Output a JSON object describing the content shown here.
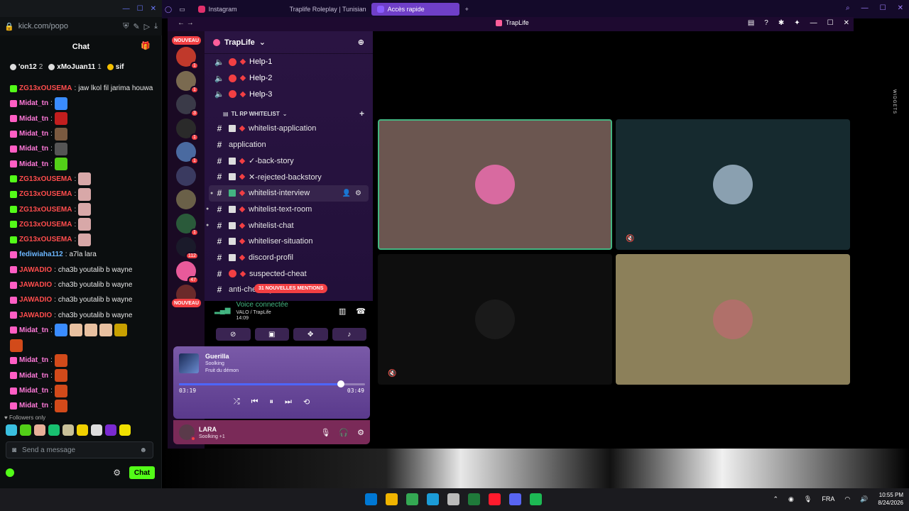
{
  "kick": {
    "url": "kick.com/popo",
    "chat_title": "Chat",
    "top_users": [
      {
        "name": "'on12",
        "count": "2"
      },
      {
        "name": "xMoJuan11",
        "count": "1"
      },
      {
        "name": "sif",
        "count": ""
      }
    ],
    "messages": [
      {
        "user": "ZG13xOUSEMA",
        "text": "jaw lkol fil jarima houwa",
        "color": "#ff4d4d",
        "badge": "green"
      },
      {
        "user": "Midat_tn",
        "text": "",
        "color": "#ff7ad9",
        "badge": "pink",
        "emotes": [
          "#3a8cff"
        ]
      },
      {
        "user": "Midat_tn",
        "text": "",
        "color": "#ff7ad9",
        "badge": "pink",
        "emotes": [
          "#c21e1e"
        ]
      },
      {
        "user": "Midat_tn",
        "text": "",
        "color": "#ff7ad9",
        "badge": "pink",
        "emotes": [
          "#7a5a40"
        ]
      },
      {
        "user": "Midat_tn",
        "text": "",
        "color": "#ff7ad9",
        "badge": "pink",
        "emotes": [
          "#555"
        ]
      },
      {
        "user": "Midat_tn",
        "text": "",
        "color": "#ff7ad9",
        "badge": "pink",
        "emotes": [
          "#53d018"
        ]
      },
      {
        "user": "ZG13xOUSEMA",
        "text": "",
        "color": "#ff4d4d",
        "badge": "green",
        "emotes": [
          "#d8a8a8"
        ]
      },
      {
        "user": "ZG13xOUSEMA",
        "text": "",
        "color": "#ff4d4d",
        "badge": "green",
        "emotes": [
          "#d8a8a8"
        ]
      },
      {
        "user": "ZG13xOUSEMA",
        "text": "",
        "color": "#ff4d4d",
        "badge": "green",
        "emotes": [
          "#d8a8a8"
        ]
      },
      {
        "user": "ZG13xOUSEMA",
        "text": "",
        "color": "#ff4d4d",
        "badge": "green",
        "emotes": [
          "#d8a8a8"
        ]
      },
      {
        "user": "ZG13xOUSEMA",
        "text": "",
        "color": "#ff4d4d",
        "badge": "green",
        "emotes": [
          "#d8a8a8"
        ]
      },
      {
        "user": "fediwiaha112",
        "text": "a7la lara",
        "color": "#6bb6ff",
        "badge": "pink"
      },
      {
        "user": "JAWADIO",
        "text": "cha3b youtalib b wayne",
        "color": "#ff4d4d",
        "badge": "pink"
      },
      {
        "user": "JAWADIO",
        "text": "cha3b youtalib b wayne",
        "color": "#ff4d4d",
        "badge": "pink"
      },
      {
        "user": "JAWADIO",
        "text": "cha3b youtalib b wayne",
        "color": "#ff4d4d",
        "badge": "pink"
      },
      {
        "user": "JAWADIO",
        "text": "cha3b youtalib b wayne",
        "color": "#ff4d4d",
        "badge": "pink"
      },
      {
        "user": "Midat_tn",
        "text": "",
        "color": "#ff7ad9",
        "badge": "pink",
        "emotes": [
          "#3a8cff",
          "#e8c0a0",
          "#e8c0a0",
          "#e8c0a0",
          "#c8a000"
        ]
      },
      {
        "user": "",
        "text": "",
        "color": "#ff7ad9",
        "badge": "none",
        "emotes": [
          "#d24a1a"
        ]
      },
      {
        "user": "Midat_tn",
        "text": "",
        "color": "#ff7ad9",
        "badge": "pink",
        "emotes": [
          "#d24a1a"
        ]
      },
      {
        "user": "Midat_tn",
        "text": "",
        "color": "#ff7ad9",
        "badge": "pink",
        "emotes": [
          "#d24a1a"
        ]
      },
      {
        "user": "Midat_tn",
        "text": "",
        "color": "#ff7ad9",
        "badge": "pink",
        "emotes": [
          "#d24a1a"
        ]
      },
      {
        "user": "Midat_tn",
        "text": "",
        "color": "#ff7ad9",
        "badge": "pink",
        "emotes": [
          "#d24a1a"
        ]
      }
    ],
    "followers_only": "Followers only",
    "input_placeholder": "Send a message",
    "chat_button": "Chat",
    "emote_row": [
      "#3ac0e0",
      "#53d018",
      "#e8b098",
      "#18c070",
      "#c8c098",
      "#f0d000",
      "#ddd",
      "#7a2ad0",
      "#f0e000"
    ]
  },
  "opera": {
    "tabs": [
      {
        "label": "Instagram",
        "color": "#e1306c",
        "active": false
      },
      {
        "label": "Traplife Roleplay | Tunisian",
        "color": "#5865f2",
        "active": false
      },
      {
        "label": "Accès rapide",
        "color": "#8a5cff",
        "active": true
      }
    ]
  },
  "discord": {
    "window_title": "TrapLife",
    "server_name": "TrapLife",
    "nouveau_label": "NOUVEAU",
    "voice_channels": [
      {
        "name": "Help-1"
      },
      {
        "name": "Help-2"
      },
      {
        "name": "Help-3"
      }
    ],
    "category": "TL RP WHITELIST",
    "channels": [
      {
        "name": "whitelist-application",
        "prefix": "hash",
        "icon": "doc",
        "dot": true
      },
      {
        "name": "application",
        "prefix": "hash",
        "icon": "",
        "dot": false
      },
      {
        "name": "✓-back-story",
        "prefix": "hash",
        "icon": "doc",
        "dot": true
      },
      {
        "name": "✕-rejected-backstory",
        "prefix": "hash",
        "icon": "doc",
        "dot": true
      },
      {
        "name": "whitelist-interview",
        "prefix": "hash",
        "icon": "check",
        "dot": true,
        "hover": true,
        "bullet": true
      },
      {
        "name": "whitelist-text-room",
        "prefix": "hash",
        "icon": "doc",
        "dot": true,
        "bullet": true
      },
      {
        "name": "whitelist-chat",
        "prefix": "hash",
        "icon": "doc",
        "dot": true,
        "bullet": true
      },
      {
        "name": "whiteliser-situation",
        "prefix": "hash",
        "icon": "doc",
        "dot": true
      },
      {
        "name": "discord-profil",
        "prefix": "hash",
        "icon": "frame",
        "dot": true
      },
      {
        "name": "suspected-cheat",
        "prefix": "hash",
        "icon": "no",
        "dot": true
      },
      {
        "name": "anti-cheat-system-check",
        "prefix": "hash",
        "icon": "",
        "dot": false
      }
    ],
    "mentions_badge": "31 NOUVELLES MENTIONS",
    "servers": [
      {
        "color": "#c0392b",
        "badge": "1"
      },
      {
        "color": "#7a6a50",
        "badge": "1"
      },
      {
        "color": "#3a3a48",
        "badge": "3"
      },
      {
        "color": "#2a2a2a",
        "badge": "1"
      },
      {
        "color": "#4a6aa0",
        "badge": "1"
      },
      {
        "color": "#3a3a60",
        "badge": ""
      },
      {
        "color": "#6a6048",
        "badge": ""
      },
      {
        "color": "#2a5a3a",
        "badge": "1"
      },
      {
        "color": "#1a1a2a",
        "badge": "112"
      },
      {
        "color": "#e85a9a",
        "badge": "47"
      },
      {
        "color": "#6a2a2a",
        "badge": ""
      }
    ],
    "voice": {
      "status": "Voice connectée",
      "channel": "VALO / TrapLife",
      "time": "14:09"
    },
    "music": {
      "title": "Guerilla",
      "artist": "Soolking",
      "album": "Fruit du démon",
      "current": "03:19",
      "total": "03:49",
      "progress": 0.87
    },
    "user": {
      "name": "LARA",
      "activity": "Soolking +1"
    },
    "tiles": [
      {
        "bg": "#6b5650",
        "avatar": "#d86aa0",
        "speaking": true,
        "muted": false
      },
      {
        "bg": "#162a2f",
        "avatar": "#8aa0b0",
        "speaking": false,
        "muted": true
      },
      {
        "bg": "#0e0e0e",
        "avatar": "#1a1a1a",
        "speaking": false,
        "muted": true
      },
      {
        "bg": "#8c805a",
        "avatar": "#b0706a",
        "speaking": false,
        "muted": false
      }
    ],
    "widgets_label": "WIDGETS"
  },
  "taskbar": {
    "apps": [
      "#0078d4",
      "#f0b400",
      "#34a853",
      "#1b9cd8",
      "#bbbbbb",
      "#1f7a3a",
      "#ff1b2d",
      "#5865f2",
      "#1db954"
    ],
    "lang": "FRA",
    "time": "10:55 PM",
    "date": "8/24/2026"
  }
}
